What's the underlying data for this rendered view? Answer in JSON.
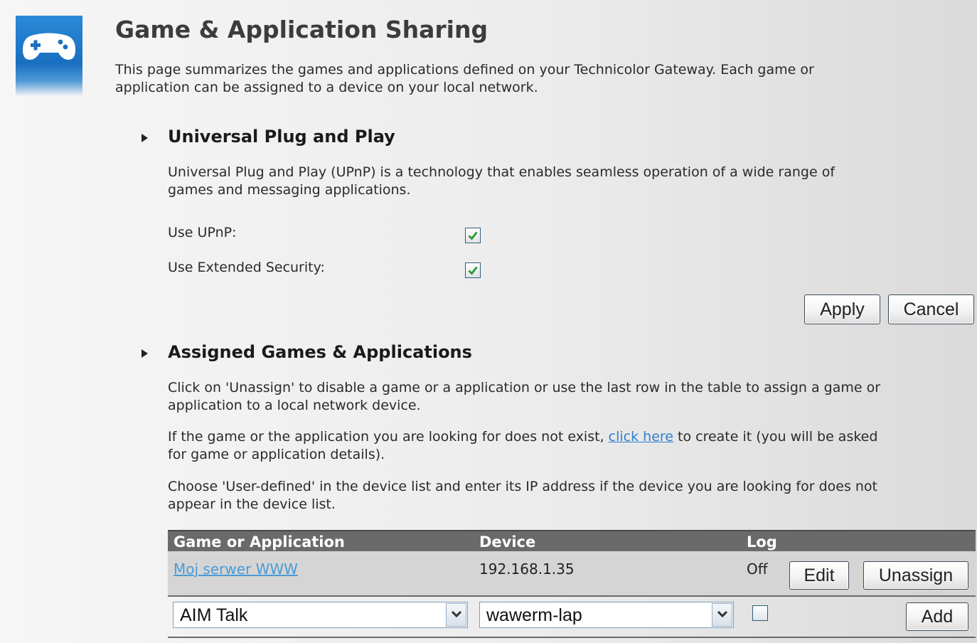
{
  "header": {
    "icon": "gamepad-icon",
    "title": "Game & Application Sharing",
    "intro_line1": "This page summarizes the games and applications defined on your Technicolor Gateway. Each game or",
    "intro_line2": "application can be assigned to a device on your local network."
  },
  "upnp": {
    "title": "Universal Plug and Play",
    "desc_line1": "Universal Plug and Play (UPnP) is a technology that enables seamless operation of a wide range of",
    "desc_line2": "games and messaging applications.",
    "use_upnp_label": "Use UPnP:",
    "use_upnp_checked": true,
    "ext_security_label": "Use Extended Security:",
    "ext_security_checked": true,
    "apply_label": "Apply",
    "cancel_label": "Cancel"
  },
  "assigned": {
    "title": "Assigned Games & Applications",
    "p1_line1": "Click on 'Unassign' to disable a game or a application or use the last row in the table to assign a game or",
    "p1_line2": "application to a local network device.",
    "p2_before_link": "If the game or the application you are looking for does not exist, ",
    "p2_link": "click here",
    "p2_after_link": " to create it (you will be asked",
    "p2_line2": "for game or application details).",
    "p3_line1": "Choose 'User-defined' in the device list and enter its IP address if the device you are looking for does not",
    "p3_line2": "appear in the device list.",
    "table": {
      "headers": [
        "Game or Application",
        "Device",
        "Log"
      ],
      "rows": [
        {
          "application": "Moj serwer WWW",
          "device": "192.168.1.35",
          "log": "Off",
          "edit_label": "Edit",
          "unassign_label": "Unassign"
        }
      ],
      "new_row": {
        "application_selected": "AIM Talk",
        "device_selected": "wawerm-lap",
        "log_checked": false,
        "add_label": "Add"
      }
    }
  }
}
